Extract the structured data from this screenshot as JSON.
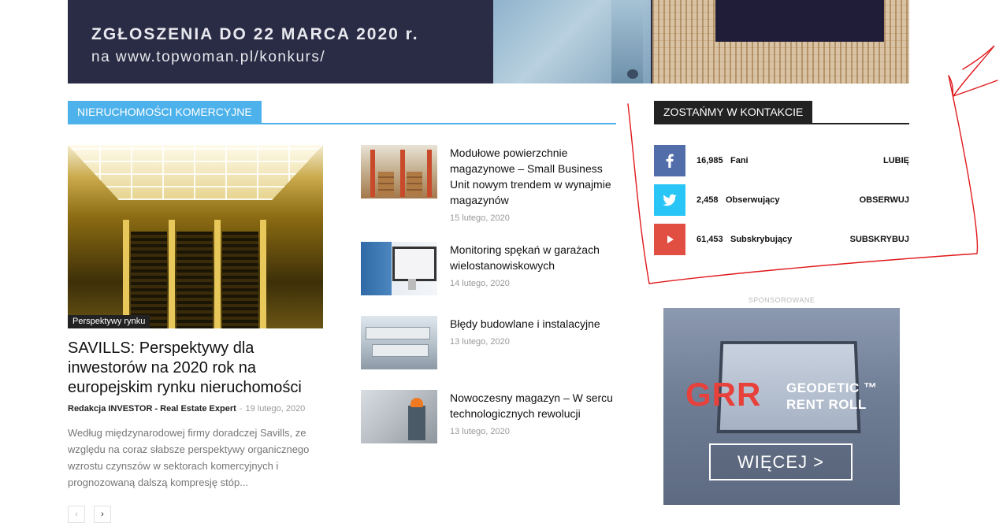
{
  "banner": {
    "line1": "ZGŁOSZENIA DO 22 MARCA 2020 r.",
    "line2": "na www.topwoman.pl/konkurs/"
  },
  "sections": {
    "commercial": "NIERUCHOMOŚCI KOMERCYJNE",
    "contact": "ZOSTAŃMY W KONTAKCIE"
  },
  "main_article": {
    "category": "Perspektywy rynku",
    "title": "SAVILLS: Perspektywy dla inwestorów na 2020 rok na europejskim rynku nieruchomości",
    "author": "Redakcja INVESTOR - Real Estate Expert",
    "separator": "-",
    "date": "19 lutego, 2020",
    "excerpt": "Według międzynarodowej firmy doradczej Savills, ze względu na coraz słabsze perspektywy organicznego wzrostu czynszów w sektorach komercyjnych i prognozowaną dalszą kompresję stóp..."
  },
  "pager": {
    "prev": "‹",
    "next": "›"
  },
  "articles": [
    {
      "title": "Modułowe powierzchnie magazynowe – Small Business Unit nowym trendem w wynajmie magazynów",
      "date": "15 lutego, 2020"
    },
    {
      "title": "Monitoring spękań w garażach wielostanowiskowych",
      "date": "14 lutego, 2020"
    },
    {
      "title": "Błędy budowlane i instalacyjne",
      "date": "13 lutego, 2020"
    },
    {
      "title": "Nowoczesny magazyn – W sercu technologicznych rewolucji",
      "date": "13 lutego, 2020"
    }
  ],
  "social": [
    {
      "network": "facebook",
      "icon": "facebook-icon",
      "count": "16,985",
      "label": "Fani",
      "action": "LUBIĘ",
      "color": "#516eab"
    },
    {
      "network": "twitter",
      "icon": "twitter-icon",
      "count": "2,458",
      "label": "Obserwujący",
      "action": "OBSERWUJ",
      "color": "#29c5f6"
    },
    {
      "network": "youtube",
      "icon": "youtube-icon",
      "count": "61,453",
      "label": "Subskrybujący",
      "action": "SUBSKRYBUJ",
      "color": "#e14e42"
    }
  ],
  "sponsored": {
    "label": "SPONSOROWANE",
    "logo": "GRR",
    "product_line1": "GEODETIC ™",
    "product_line2": "RENT ROLL",
    "cta": "WIĘCEJ >"
  },
  "colors": {
    "accent": "#4db2ec",
    "annotation": "#e0191b"
  }
}
